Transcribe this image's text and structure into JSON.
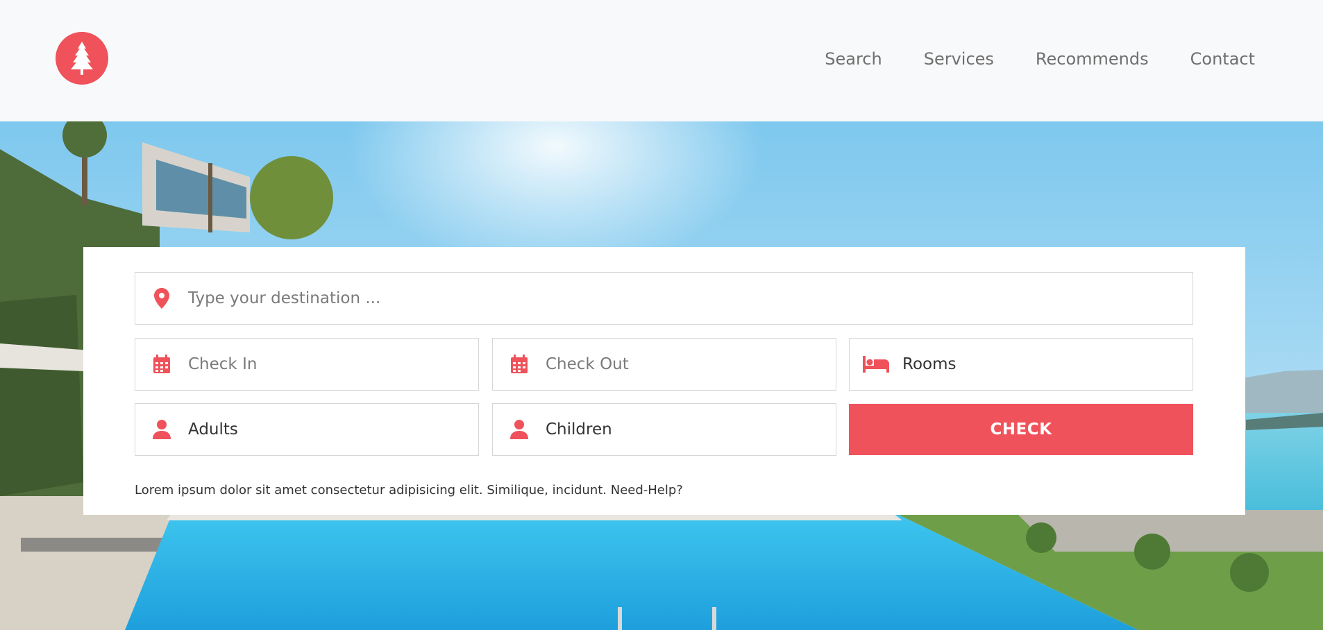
{
  "colors": {
    "accent": "#ef525a",
    "header_bg": "#f8f9fb",
    "card_bg": "#ffffff"
  },
  "header": {
    "logo_icon": "tree-icon",
    "nav": [
      {
        "label": "Search"
      },
      {
        "label": "Services"
      },
      {
        "label": "Recommends"
      },
      {
        "label": "Contact"
      }
    ]
  },
  "booking": {
    "destination": {
      "placeholder": "Type your destination ...",
      "icon": "map-pin-icon"
    },
    "check_in": {
      "placeholder": "Check In",
      "icon": "calendar-icon"
    },
    "check_out": {
      "placeholder": "Check Out",
      "icon": "calendar-icon"
    },
    "rooms": {
      "label": "Rooms",
      "icon": "bed-icon"
    },
    "adults": {
      "label": "Adults",
      "icon": "user-icon"
    },
    "children": {
      "label": "Children",
      "icon": "user-icon"
    },
    "check_button": "CHECK",
    "note": "Lorem ipsum dolor sit amet consectetur adipisicing elit. Similique, incidunt. Need-Help?"
  }
}
